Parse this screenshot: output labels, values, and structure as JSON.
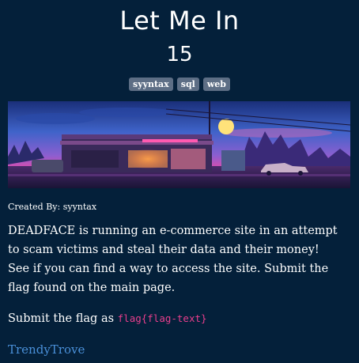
{
  "challenge": {
    "title": "Let Me In",
    "points": "15",
    "tags": [
      "syyntax",
      "sql",
      "web"
    ],
    "author": "Created By: syyntax",
    "description": "DEADFACE is running an e-commerce site in an attempt to scam victims and steal their data and their money! See if you can find a way to access the site. Submit the flag found on the main page.",
    "flag_prefix": "Submit the flag as ",
    "flag_format": "flag{flag-text}",
    "link_text": "TrendyTrove"
  },
  "banner": {
    "description_icon": "storefront-night-illustration",
    "colors": {
      "sky_top": "#1a2f7a",
      "sky_mid": "#4b6fd6",
      "horizon": "#e84aa8",
      "moon": "#ffe27a",
      "ground": "#2a1f4a"
    }
  },
  "colors": {
    "background": "#04203a",
    "tag_bg": "#5d6e85",
    "code": "#e83e8c",
    "link": "#4a90d9"
  }
}
